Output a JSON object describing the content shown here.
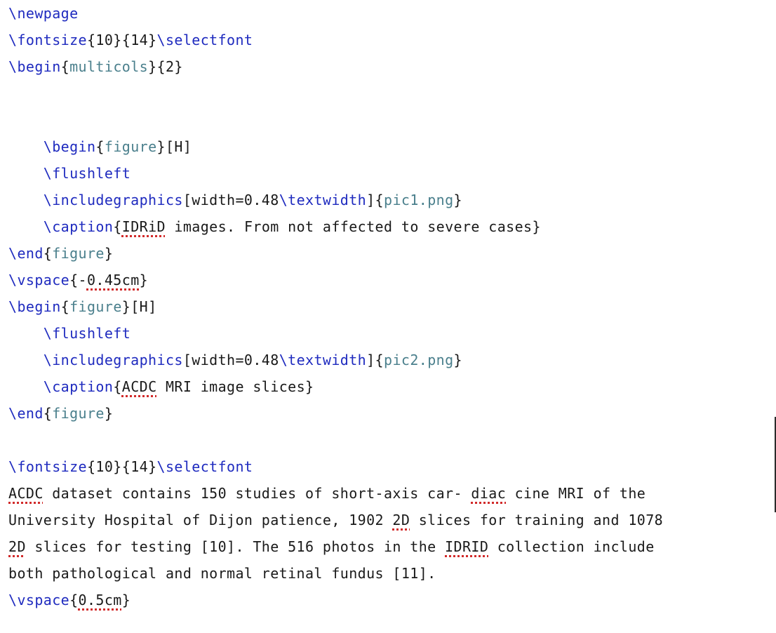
{
  "editor": {
    "lines": [
      [
        {
          "t": "\\newpage",
          "c": "cmd"
        }
      ],
      [
        {
          "t": "\\fontsize",
          "c": "cmd"
        },
        {
          "t": "{10}{14}",
          "c": "br"
        },
        {
          "t": "\\selectfont",
          "c": "cmd"
        }
      ],
      [
        {
          "t": "\\begin",
          "c": "cmd"
        },
        {
          "t": "{",
          "c": "br"
        },
        {
          "t": "multicols",
          "c": "arg"
        },
        {
          "t": "}{2}",
          "c": "br"
        }
      ],
      [],
      [],
      [
        {
          "t": "    ",
          "c": "br"
        },
        {
          "t": "\\begin",
          "c": "cmd"
        },
        {
          "t": "{",
          "c": "br"
        },
        {
          "t": "figure",
          "c": "arg"
        },
        {
          "t": "}[H]",
          "c": "br"
        }
      ],
      [
        {
          "t": "    ",
          "c": "br"
        },
        {
          "t": "\\flushleft",
          "c": "cmd"
        }
      ],
      [
        {
          "t": "    ",
          "c": "br"
        },
        {
          "t": "\\includegraphics",
          "c": "cmd"
        },
        {
          "t": "[width=0.48",
          "c": "br"
        },
        {
          "t": "\\textwidth",
          "c": "cmd"
        },
        {
          "t": "]{",
          "c": "br"
        },
        {
          "t": "pic1.png",
          "c": "arg"
        },
        {
          "t": "}",
          "c": "br"
        }
      ],
      [
        {
          "t": "    ",
          "c": "br"
        },
        {
          "t": "\\caption",
          "c": "cmd"
        },
        {
          "t": "{",
          "c": "br"
        },
        {
          "t": "IDRiD",
          "c": "br",
          "s": true
        },
        {
          "t": " images. From not affected to severe cases}",
          "c": "br"
        }
      ],
      [
        {
          "t": "\\end",
          "c": "cmd"
        },
        {
          "t": "{",
          "c": "br"
        },
        {
          "t": "figure",
          "c": "arg"
        },
        {
          "t": "}",
          "c": "br"
        }
      ],
      [
        {
          "t": "\\vspace",
          "c": "cmd"
        },
        {
          "t": "{-",
          "c": "br"
        },
        {
          "t": "0.45cm",
          "c": "br",
          "s": true
        },
        {
          "t": "}",
          "c": "br"
        }
      ],
      [
        {
          "t": "\\begin",
          "c": "cmd"
        },
        {
          "t": "{",
          "c": "br"
        },
        {
          "t": "figure",
          "c": "arg"
        },
        {
          "t": "}[H]",
          "c": "br"
        }
      ],
      [
        {
          "t": "    ",
          "c": "br"
        },
        {
          "t": "\\flushleft",
          "c": "cmd"
        }
      ],
      [
        {
          "t": "    ",
          "c": "br"
        },
        {
          "t": "\\includegraphics",
          "c": "cmd"
        },
        {
          "t": "[width=0.48",
          "c": "br"
        },
        {
          "t": "\\textwidth",
          "c": "cmd"
        },
        {
          "t": "]{",
          "c": "br"
        },
        {
          "t": "pic2.png",
          "c": "arg"
        },
        {
          "t": "}",
          "c": "br"
        }
      ],
      [
        {
          "t": "    ",
          "c": "br"
        },
        {
          "t": "\\caption",
          "c": "cmd"
        },
        {
          "t": "{",
          "c": "br"
        },
        {
          "t": "ACDC",
          "c": "br",
          "s": true
        },
        {
          "t": " MRI image slices}",
          "c": "br"
        }
      ],
      [
        {
          "t": "\\end",
          "c": "cmd"
        },
        {
          "t": "{",
          "c": "br"
        },
        {
          "t": "figure",
          "c": "arg"
        },
        {
          "t": "}",
          "c": "br"
        }
      ],
      [],
      [
        {
          "t": "\\fontsize",
          "c": "cmd"
        },
        {
          "t": "{10}{14}",
          "c": "br"
        },
        {
          "t": "\\selectfont",
          "c": "cmd"
        }
      ],
      [
        {
          "t": "ACDC",
          "c": "br",
          "s": true
        },
        {
          "t": " dataset contains 150 studies of short-axis car- ",
          "c": "br"
        },
        {
          "t": "diac",
          "c": "br",
          "s": true
        },
        {
          "t": " cine MRI of the",
          "c": "br"
        }
      ],
      [
        {
          "t": "University Hospital of Dijon patience, 1902 ",
          "c": "br"
        },
        {
          "t": "2D",
          "c": "br",
          "s": true
        },
        {
          "t": " slices for training and 1078",
          "c": "br"
        }
      ],
      [
        {
          "t": "2D",
          "c": "br",
          "s": true
        },
        {
          "t": " slices for testing [10]. The 516 photos in the ",
          "c": "br"
        },
        {
          "t": "IDRID",
          "c": "br",
          "s": true
        },
        {
          "t": " collection include",
          "c": "br"
        }
      ],
      [
        {
          "t": "both pathological and normal retinal fundus [11].",
          "c": "br"
        }
      ],
      [
        {
          "t": "\\vspace",
          "c": "cmd"
        },
        {
          "t": "{",
          "c": "br"
        },
        {
          "t": "0.5cm",
          "c": "br",
          "s": true
        },
        {
          "t": "}",
          "c": "br"
        }
      ]
    ]
  },
  "colors": {
    "command": "#1f2bbf",
    "argument": "#4a7f8c",
    "text": "#1a1a1a",
    "spellcheck": "#d12a2a"
  }
}
